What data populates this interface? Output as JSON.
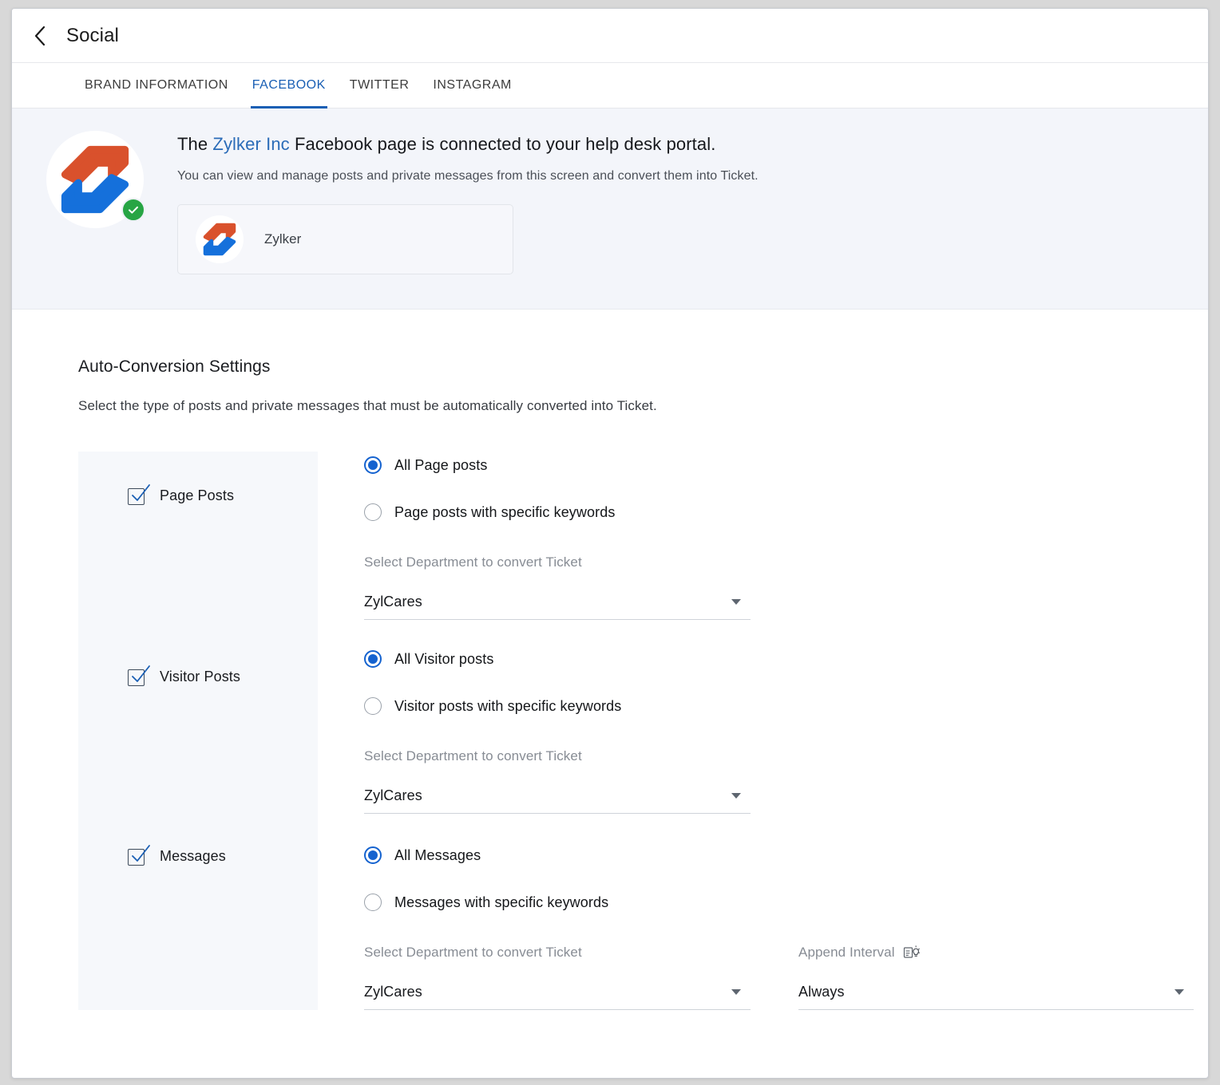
{
  "header": {
    "back_icon": "chevron-left-icon",
    "title": "Social"
  },
  "tabs": [
    {
      "label": "BRAND INFORMATION",
      "active": false
    },
    {
      "label": "FACEBOOK",
      "active": true
    },
    {
      "label": "TWITTER",
      "active": false
    },
    {
      "label": "INSTAGRAM",
      "active": false
    }
  ],
  "banner": {
    "avatar_icon": "zylker-logo-icon",
    "verified_icon": "verified-check-icon",
    "headline_prefix": "The ",
    "brand": "Zylker Inc",
    "headline_suffix": " Facebook page is connected to your help desk portal.",
    "description": "You can view and manage posts and private messages from this screen and convert them into Ticket.",
    "page_card": {
      "icon": "zylker-logo-icon",
      "name": "Zylker"
    }
  },
  "auto_conversion": {
    "title": "Auto-Conversion Settings",
    "description": "Select the type of posts and private messages that must be automatically converted into Ticket.",
    "categories": [
      {
        "label": "Page Posts",
        "checked": true
      },
      {
        "label": "Visitor Posts",
        "checked": true
      },
      {
        "label": "Messages",
        "checked": true
      }
    ],
    "groups": [
      {
        "options": [
          {
            "label": "All Page posts",
            "selected": true
          },
          {
            "label": "Page posts with specific keywords",
            "selected": false
          }
        ],
        "department_label": "Select Department to convert Ticket",
        "department_value": "ZylCares"
      },
      {
        "options": [
          {
            "label": "All Visitor posts",
            "selected": true
          },
          {
            "label": "Visitor posts with specific keywords",
            "selected": false
          }
        ],
        "department_label": "Select Department to convert Ticket",
        "department_value": "ZylCares"
      },
      {
        "options": [
          {
            "label": "All Messages",
            "selected": true
          },
          {
            "label": "Messages with specific keywords",
            "selected": false
          }
        ],
        "department_label": "Select Department to convert Ticket",
        "department_value": "ZylCares",
        "append_interval_label": "Append Interval",
        "append_interval_icon": "hint-lightbulb-icon",
        "append_interval_value": "Always"
      }
    ]
  },
  "colors": {
    "accent": "#1a5fb4",
    "radio_selected": "#1462cf",
    "brand_link": "#2b6cb8",
    "verified_green": "#27a544",
    "logo_orange": "#d9512c",
    "logo_blue": "#1570db",
    "banner_bg": "#f3f5fa",
    "side_panel_bg": "#f6f8fb"
  }
}
